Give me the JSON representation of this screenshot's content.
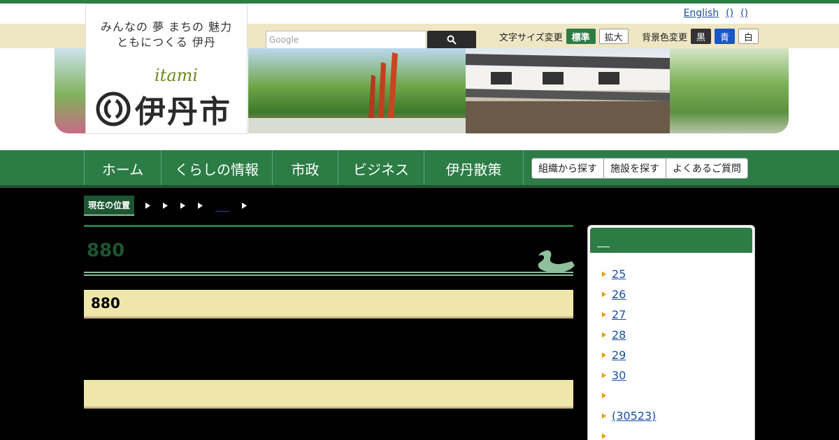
{
  "header": {
    "slogan_line1": "みんなの 夢 まちの 魅力",
    "slogan_line2": "ともにつくる 伊丹",
    "logo_roman": "itami",
    "logo_city": "伊丹市",
    "lang_links": [
      "English",
      "()",
      "()"
    ],
    "search": {
      "placeholder": "Google"
    },
    "font_size_label": "文字サイズ変更",
    "font_size_standard": "標準",
    "font_size_large": "拡大",
    "bg_color_label": "背景色変更",
    "bg_black": "黒",
    "bg_blue": "青",
    "bg_white": "白"
  },
  "nav": {
    "items": [
      "ホーム",
      "くらしの情報",
      "市政",
      "ビジネス",
      "伊丹散策"
    ],
    "buttons": [
      "組織から探す",
      "施設を探す",
      "よくあるご質問"
    ]
  },
  "breadcrumb": {
    "label": "現在の位置"
  },
  "main": {
    "title": "880",
    "h2": "880",
    "h2_second": ""
  },
  "sidebar": {
    "items": [
      "25",
      "26",
      "27",
      "28",
      "29",
      "30",
      "",
      "(30523)",
      ""
    ]
  },
  "colors": {
    "brand_green": "#2c7c46",
    "dark_green": "#1c5530",
    "beige": "#efe6c4",
    "heading_bar": "#efe6ab"
  }
}
